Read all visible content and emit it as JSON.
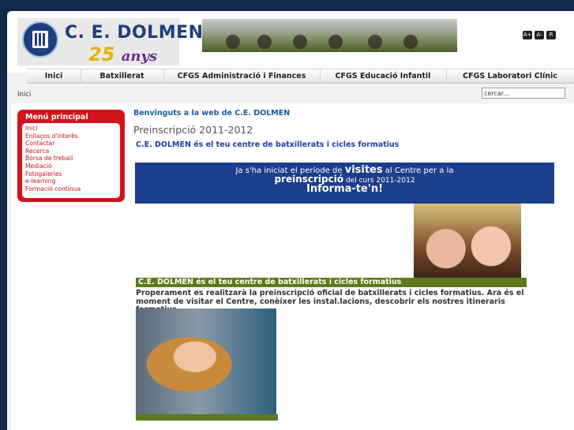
{
  "header": {
    "logo": {
      "name": "C. E. DOLMEN",
      "years": "25",
      "years_word": "anys"
    },
    "font_size_buttons": [
      "A+",
      "A-",
      "R"
    ]
  },
  "nav": {
    "items": [
      "Inici",
      "Batxillerat",
      "CFGS Administració i Finances",
      "CFGS Educació Infantil",
      "CFGS Laboratori Clínic"
    ]
  },
  "breadcrumb": "Inici",
  "search": {
    "value": "cercar..."
  },
  "menu": {
    "title": "Menú principal",
    "items": [
      "Inici",
      "Enllaços d'interès",
      "Contactar",
      "Recerca",
      "Borsa de treball",
      "Mediació",
      "Fotogaleries",
      "e-learning",
      "Formació contínua"
    ]
  },
  "main": {
    "welcome": "Benvinguts a la web de C.E. DOLMEN",
    "article_title": "Preinscripció 2011-2012",
    "tagline": "C.E. DOLMEN és el teu centre de batxillerats i cicles formatius",
    "promo": {
      "line1_pre": "Ja s'ha iniciat el període de ",
      "line1_bold": "visites",
      "line1_post": " al Centre per a la",
      "line2_bold": "preinscripció",
      "line2_post": " del curs 2011-2012",
      "line3": "Informa-te'n!"
    },
    "caption": "C.E. DOLMEN és el teu centre de batxillerats i cicles formatius",
    "description": "Properament es realitzarà la preinscripció oficial de batxillerats i cicles formatius. Ara és el moment de visitar el Centre, conèixer les instal.lacions, descobrir els nostres itineraris formatius,..."
  },
  "colors": {
    "outer_background": "#0e2a48",
    "menu_red": "#d2151c",
    "promo_blue": "#1d3e8c",
    "caption_green": "#5d7a1c",
    "link_blue": "#1a5aa0"
  }
}
